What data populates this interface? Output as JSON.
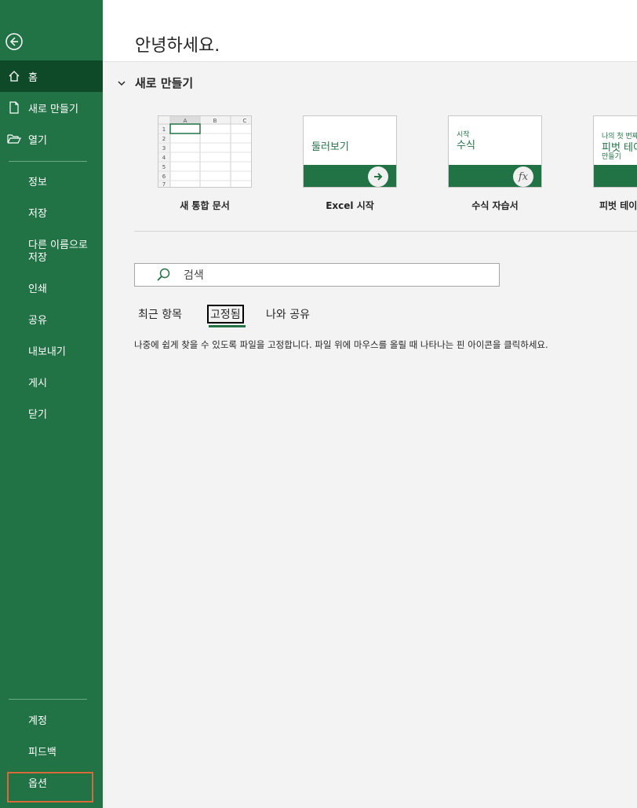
{
  "greeting": "안녕하세요.",
  "sidebar": {
    "home": "홈",
    "new": "새로 만들기",
    "open": "열기",
    "info": "정보",
    "save": "저장",
    "save_as": "다른 이름으로\n저장",
    "print": "인쇄",
    "share": "공유",
    "export": "내보내기",
    "publish": "게시",
    "close": "닫기",
    "account": "계정",
    "feedback": "피드백",
    "options": "옵션"
  },
  "new_section": {
    "title": "새로 만들기",
    "templates": [
      {
        "label": "새 통합 문서"
      },
      {
        "label": "Excel 시작",
        "thumb_text": "둘러보기"
      },
      {
        "label": "수식 자습서",
        "thumb_small": "시작",
        "thumb_text": "수식"
      },
      {
        "label": "피벗 테이",
        "thumb_small": "나의 첫 번째",
        "thumb_text": "피벗 테이",
        "thumb_sub": "만들기"
      }
    ],
    "grid_cols": [
      "A",
      "B",
      "C"
    ],
    "grid_rows": [
      "1",
      "2",
      "3",
      "4",
      "5",
      "6",
      "7"
    ]
  },
  "search": {
    "placeholder": "검색"
  },
  "tabs": [
    "최근 항목",
    "고정됨",
    "나와 공유"
  ],
  "active_tab": "고정됨",
  "hint": "나중에 쉽게 찾을 수 있도록 파일을 고정합니다. 파일 위에 마우스를 올릴 때 나타나는 핀 아이콘을 클릭하세요.",
  "colors": {
    "sidebar": "#217346",
    "active": "#0f4a28",
    "highlight": "#d86a3a"
  }
}
